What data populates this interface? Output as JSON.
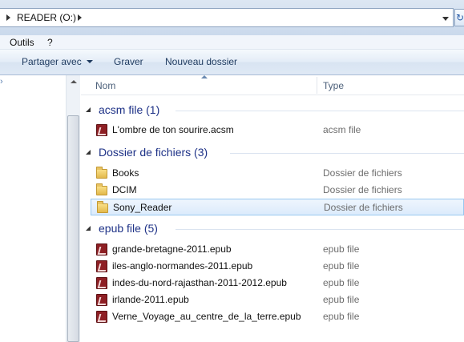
{
  "address": {
    "path": "READER (O:)"
  },
  "menu": {
    "items": [
      "Outils",
      "?"
    ]
  },
  "toolbar": {
    "share": "Partager avec",
    "burn": "Graver",
    "new_folder": "Nouveau dossier"
  },
  "columns": {
    "name": "Nom",
    "type": "Type"
  },
  "groups": [
    {
      "title": "acsm file (1)",
      "items": [
        {
          "name": "L'ombre de ton sourire.acsm",
          "type": "acsm file",
          "icon": "ebook-icon"
        }
      ]
    },
    {
      "title": "Dossier de fichiers (3)",
      "items": [
        {
          "name": "Books",
          "type": "Dossier de fichiers",
          "icon": "folder-icon"
        },
        {
          "name": "DCIM",
          "type": "Dossier de fichiers",
          "icon": "folder-icon"
        },
        {
          "name": "Sony_Reader",
          "type": "Dossier de fichiers",
          "icon": "folder-icon",
          "selected": true
        }
      ]
    },
    {
      "title": "epub file (5)",
      "items": [
        {
          "name": "grande-bretagne-2011.epub",
          "type": "epub file",
          "icon": "ebook-icon"
        },
        {
          "name": "iles-anglo-normandes-2011.epub",
          "type": "epub file",
          "icon": "ebook-icon"
        },
        {
          "name": "indes-du-nord-rajasthan-2011-2012.epub",
          "type": "epub file",
          "icon": "ebook-icon"
        },
        {
          "name": "irlande-2011.epub",
          "type": "epub file",
          "icon": "ebook-icon"
        },
        {
          "name": "Verne_Voyage_au_centre_de_la_terre.epub",
          "type": "epub file",
          "icon": "ebook-icon"
        }
      ]
    }
  ],
  "colors": {
    "group_title": "#1e3287",
    "selection_border": "#99c8f0",
    "epub_icon": "#8e1f24",
    "folder_icon": "#e3b84c"
  }
}
